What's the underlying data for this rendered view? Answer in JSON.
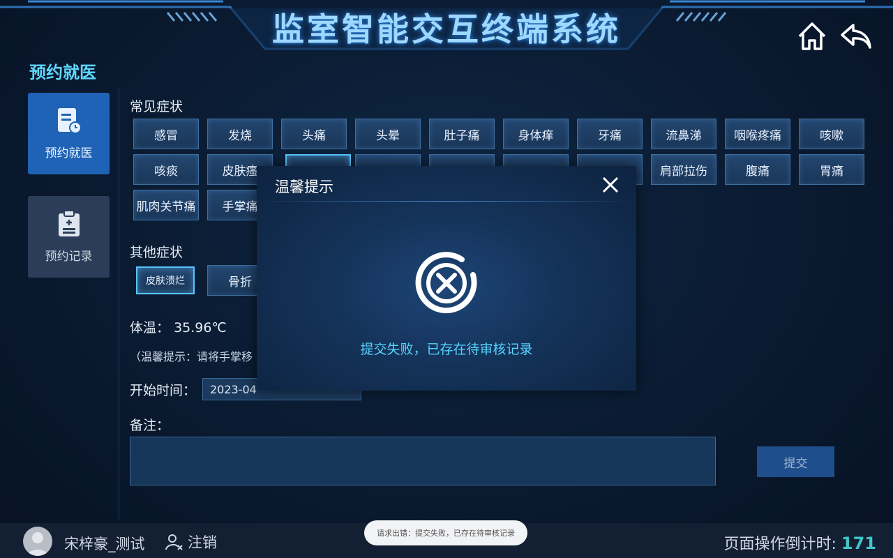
{
  "header": {
    "title": "监室智能交互终端系统",
    "home_icon": "home-icon",
    "back_icon": "back-arrow-icon"
  },
  "sidebar": {
    "section_title": "预约就医",
    "items": [
      {
        "label": "预约就医",
        "icon": "medical-doc-icon",
        "active": true
      },
      {
        "label": "预约记录",
        "icon": "clipboard-icon",
        "active": false
      }
    ]
  },
  "common_symptoms": {
    "label": "常见症状",
    "chips": [
      "感冒",
      "发烧",
      "头痛",
      "头晕",
      "肚子痛",
      "身体痒",
      "牙痛",
      "流鼻涕",
      "咽喉疼痛",
      "咳嗽",
      "咳痰",
      "皮肤瘙",
      "",
      "",
      "",
      "",
      "",
      "肩部拉伤",
      "腹痛",
      "胃痛",
      "肌肉关节痛",
      "手掌痛"
    ]
  },
  "other_symptoms": {
    "label": "其他症状",
    "chips": [
      "皮肤溃烂",
      "骨折"
    ]
  },
  "temperature": {
    "label": "体温：",
    "value": "35.96℃"
  },
  "tip": {
    "text": "（温馨提示：请将手掌移"
  },
  "start_time": {
    "label": "开始时间：",
    "value": "2023-04-"
  },
  "remark": {
    "label": "备注：",
    "value": ""
  },
  "submit": {
    "label": "提交"
  },
  "footer": {
    "username": "宋梓豪_测试",
    "logout_label": "注销",
    "countdown_label": "页面操作倒计时:",
    "countdown_value": "171"
  },
  "toast": {
    "text": "请求出错：提交失败，已存在待审核记录"
  },
  "modal": {
    "title": "温馨提示",
    "message": "提交失败，已存在待审核记录"
  },
  "colors": {
    "accent": "#5fd7ff",
    "active_blue": "#1f63b6",
    "countdown": "#41c6c9"
  }
}
